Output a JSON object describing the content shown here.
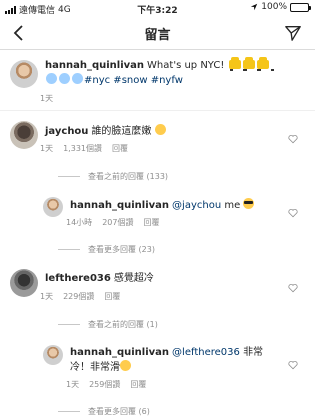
{
  "status_bar": {
    "carrier": "遠傳電信",
    "network": "4G",
    "time": "下午3:22",
    "battery": "100%",
    "battery_level": 1.0
  },
  "nav": {
    "title": "留言"
  },
  "caption": {
    "username": "hannah_quinlivan",
    "text": "What's up NYC!",
    "hashtags": "#nyc #snow #nyfw",
    "time": "1天"
  },
  "comments": [
    {
      "username": "jaychou",
      "text": "誰的臉這麼嫩",
      "time": "1天",
      "likes": "1,331個讚",
      "reply_label": "回覆",
      "view_more": "查看之前的回覆 (133)"
    },
    {
      "username": "hannah_quinlivan",
      "mention": "@jaychou",
      "text": "me",
      "time": "14小時",
      "likes": "207個讚",
      "reply_label": "回覆",
      "view_more": "查看更多回覆 (23)"
    },
    {
      "username": "lefthere036",
      "text": "感覺超冷",
      "time": "1天",
      "likes": "229個讚",
      "reply_label": "回覆",
      "view_more": "查看之前的回覆 (1)"
    },
    {
      "username": "hannah_quinlivan",
      "mention": "@lefthere036",
      "text_line1": "非常",
      "text_line2": "冷！非常滑",
      "time": "1天",
      "likes": "259個讚",
      "reply_label": "回覆",
      "view_more": "查看更多回覆 (6)"
    }
  ]
}
